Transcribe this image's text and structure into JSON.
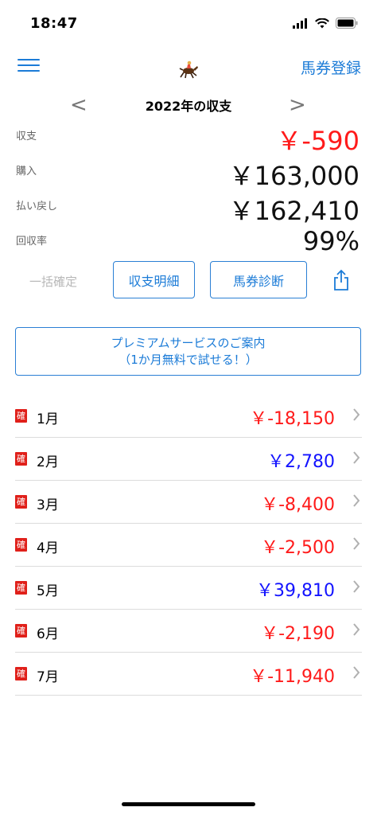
{
  "status": {
    "time": "18:47"
  },
  "nav": {
    "register_label": "馬券登録"
  },
  "year": {
    "title": "2022年の収支",
    "prev": "<",
    "next": ">"
  },
  "summary": [
    {
      "label": "収支",
      "value": "￥-590",
      "color": "red"
    },
    {
      "label": "購入",
      "value": "￥163,000",
      "color": "black"
    },
    {
      "label": "払い戻し",
      "value": "￥162,410",
      "color": "black"
    },
    {
      "label": "回収率",
      "value": "99%",
      "color": "black"
    }
  ],
  "actions": {
    "bulk_confirm": "一括確定",
    "detail": "収支明細",
    "diagnosis": "馬券診断"
  },
  "premium": {
    "line1": "プレミアムサービスのご案内",
    "line2": "（1か月無料で試せる！）"
  },
  "months": [
    {
      "badge": "確",
      "label": "1月",
      "amount": "￥-18,150",
      "color": "red"
    },
    {
      "badge": "確",
      "label": "2月",
      "amount": "￥2,780",
      "color": "blue"
    },
    {
      "badge": "確",
      "label": "3月",
      "amount": "￥-8,400",
      "color": "red"
    },
    {
      "badge": "確",
      "label": "4月",
      "amount": "￥-2,500",
      "color": "red"
    },
    {
      "badge": "確",
      "label": "5月",
      "amount": "￥39,810",
      "color": "blue"
    },
    {
      "badge": "確",
      "label": "6月",
      "amount": "￥-2,190",
      "color": "red"
    },
    {
      "badge": "確",
      "label": "7月",
      "amount": "￥-11,940",
      "color": "red"
    }
  ],
  "colors": {
    "accent": "#1b7bd7",
    "negative": "#ff1a1a",
    "positive": "#1414ff",
    "badge": "#e0201a"
  }
}
